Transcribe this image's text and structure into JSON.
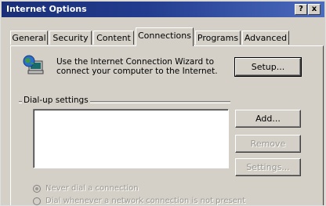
{
  "window": {
    "title": "Internet Options",
    "help_label": "?",
    "close_label": "x"
  },
  "tabs": [
    {
      "label": "General",
      "active": false
    },
    {
      "label": "Security",
      "active": false
    },
    {
      "label": "Content",
      "active": false
    },
    {
      "label": "Connections",
      "active": true
    },
    {
      "label": "Programs",
      "active": false
    },
    {
      "label": "Advanced",
      "active": false
    }
  ],
  "connections": {
    "wizard_text": "Use the Internet Connection Wizard to connect your computer to the Internet.",
    "setup_label": "Setup...",
    "dialup_label": "Dial-up settings",
    "dialup_entries": [],
    "add_label": "Add...",
    "remove_label": "Remove",
    "settings_label": "Settings...",
    "radio_options": [
      {
        "label": "Never dial a connection",
        "checked": true,
        "enabled": false
      },
      {
        "label": "Dial whenever a network connection is not present",
        "checked": false,
        "enabled": false
      }
    ]
  },
  "colors": {
    "titlebar_start": "#1a2f78",
    "titlebar_end": "#4b6bbe",
    "face": "#d4d0c8",
    "disabled_text": "#9a9890"
  },
  "icons": {
    "wizard": "computer-globe-icon"
  }
}
